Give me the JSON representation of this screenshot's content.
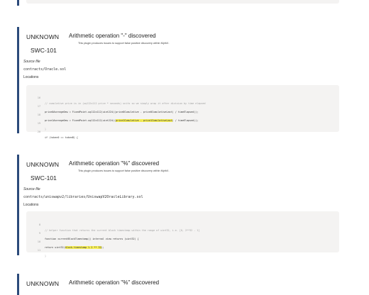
{
  "findings": [
    {
      "severity": "UNKNOWN",
      "swc": "SWC-101",
      "title": "Arithmetic operation \"-\" discovered",
      "description": "This plugin produces issues to support false positive discovery within MythX.",
      "source_label": "Source file",
      "source_path": "contracts/Oracle.sol",
      "locations_label": "Locations",
      "code_lines": [
        {
          "n": "16",
          "text": "// cumulative price is in (uq112x112 price * seconds) units so we simply wrap it after division by time elapsed"
        },
        {
          "n": "17",
          "text": "price0Average0ew = FixedPoint.uq112x112(uint224((price0Cumulative - price0CumulativeLast) / timeElapsed));"
        },
        {
          "n": "18",
          "text": "price1Average0ew = FixedPoint.uq112x112(uint224((price1Cumulative - price1CumulativeLast) / timeElapsed));"
        },
        {
          "n": "19",
          "text": "}"
        },
        {
          "n": "20",
          "text": "if (token0 == tokenB) {"
        }
      ]
    },
    {
      "severity": "UNKNOWN",
      "swc": "SWC-101",
      "title": "Arithmetic operation \"%\" discovered",
      "description": "This plugin produces issues to support false positive discovery within MythX.",
      "source_label": "Source file",
      "source_path": "contracts/uniswapv2/libraries/UniswapV2OracleLibrary.sol",
      "locations_label": "Locations",
      "code_lines": [
        {
          "n": "8",
          "text": "// helper function that returns the current block timestamp within the range of uint32, i.e. [0, 2**32 - 1]"
        },
        {
          "n": "9",
          "text": "function currentBlockTimestamp() internal view returns (uint32) {"
        },
        {
          "n": "10",
          "text": "return uint32(block.timestamp % 2 ** 32);"
        },
        {
          "n": "11",
          "text": "}"
        }
      ]
    },
    {
      "severity": "UNKNOWN",
      "title": "Arithmetic operation \"%\" discovered"
    }
  ]
}
